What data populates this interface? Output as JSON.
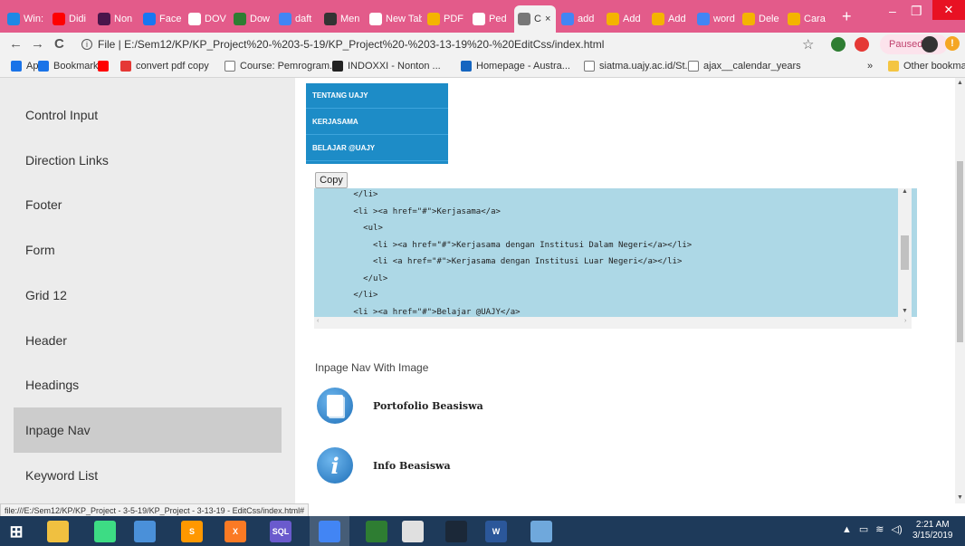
{
  "browser": {
    "tabs": [
      {
        "label": "Win:",
        "icon": "wifi-icon",
        "color": "#1e88e5"
      },
      {
        "label": "Didi",
        "icon": "youtube-icon",
        "color": "#ff0000"
      },
      {
        "label": "Non",
        "icon": "slack-icon",
        "color": "#4a154b"
      },
      {
        "label": "Face",
        "icon": "facebook-icon",
        "color": "#1877f2"
      },
      {
        "label": "DOV",
        "icon": "page-icon",
        "color": "#ffffff"
      },
      {
        "label": "Dow",
        "icon": "download-icon",
        "color": "#2e7d32"
      },
      {
        "label": "daft",
        "icon": "google-icon",
        "color": "#4285f4"
      },
      {
        "label": "Men",
        "icon": "y-icon",
        "color": "#333333"
      },
      {
        "label": "New Tab",
        "icon": "newtab-icon",
        "color": "#ffffff"
      },
      {
        "label": "PDF",
        "icon": "pdf-icon",
        "color": "#f4b400"
      },
      {
        "label": "Ped",
        "icon": "page-icon",
        "color": "#ffffff"
      },
      {
        "label": "C",
        "icon": "page-icon",
        "color": "#777777",
        "active": true
      },
      {
        "label": "add",
        "icon": "google-icon",
        "color": "#4285f4"
      },
      {
        "label": "Add",
        "icon": "puzzle-icon",
        "color": "#f4b400"
      },
      {
        "label": "Add",
        "icon": "puzzle-icon",
        "color": "#f4b400"
      },
      {
        "label": "word",
        "icon": "google-icon",
        "color": "#4285f4"
      },
      {
        "label": "Dele",
        "icon": "puzzle-icon",
        "color": "#f4b400"
      },
      {
        "label": "Cara",
        "icon": "puzzle-icon",
        "color": "#f4b400"
      }
    ],
    "new_tab_label": "+",
    "minimize": "–",
    "maximize": "❐",
    "close": "✕",
    "back": "←",
    "forward": "→",
    "reload": "C",
    "info_glyph": "i",
    "url": "File | E:/Sem12/KP/KP_Project%20-%203-5-19/KP_Project%20-%203-13-19%20-%20EditCss/index.html",
    "star": "☆",
    "paused_label": "Paused",
    "warning_glyph": "!"
  },
  "bookmarks": [
    {
      "label": "Apps",
      "icon": "apps-icon",
      "color": "#1a73e8"
    },
    {
      "label": "Bookmarks",
      "icon": "star-icon",
      "color": "#1a73e8"
    },
    {
      "label": "",
      "icon": "youtube-icon",
      "color": "#ff0000"
    },
    {
      "label": "convert pdf copy",
      "icon": "s-icon",
      "color": "#e53935"
    },
    {
      "label": "Course: Pemrogram...",
      "icon": "page-icon",
      "color": "#ffffff"
    },
    {
      "label": "INDOXXI - Nonton ...",
      "icon": "film-icon",
      "color": "#222222"
    },
    {
      "label": "Homepage - Austra...",
      "icon": "asterisk-icon",
      "color": "#1565c0"
    },
    {
      "label": "siatma.uajy.ac.id/St...",
      "icon": "page-icon",
      "color": "#ffffff"
    },
    {
      "label": "ajax__calendar_years",
      "icon": "page-icon",
      "color": "#ffffff"
    }
  ],
  "bookmarks_more": "»",
  "other_bookmarks": "Other bookmarks",
  "sidebar": {
    "items": [
      {
        "label": "Control Input"
      },
      {
        "label": "Direction Links"
      },
      {
        "label": "Footer"
      },
      {
        "label": "Form"
      },
      {
        "label": "Grid 12"
      },
      {
        "label": "Header"
      },
      {
        "label": "Headings"
      },
      {
        "label": "Inpage Nav",
        "active": true
      },
      {
        "label": "Keyword List"
      }
    ]
  },
  "menu": {
    "items": [
      "TENTANG UAJY",
      "KERJASAMA",
      "BELAJAR @UAJY"
    ]
  },
  "copy_button": "Copy",
  "code_lines": [
    "        </li>",
    "        <li ><a href=\"#\">Kerjasama</a>",
    "          <ul>",
    "            <li ><a href=\"#\">Kerjasama dengan Institusi Dalam Negeri</a></li>",
    "            <li <a href=\"#\">Kerjasama dengan Institusi Luar Negeri</a></li>",
    "          </ul>",
    "        </li>",
    "        <li ><a href=\"#\">Belajar @UAJY</a>"
  ],
  "scroll_left_glyph": "‹",
  "scroll_right_glyph": "›",
  "scroll_up_glyph": "▲",
  "scroll_down_glyph": "▼",
  "inpage_image": {
    "title": "Inpage Nav With Image",
    "items": [
      {
        "label": "Portofolio Beasiswa",
        "icon": "document-icon",
        "color": "#1e6fb8"
      },
      {
        "label": "Info Beasiswa",
        "icon": "info-icon",
        "color": "#1e6fb8"
      }
    ]
  },
  "status_url": "file:///E:/Sem12/KP/KP_Project - 3-5-19/KP_Project - 3-13-19 - EditCss/index.html#",
  "taskbar": {
    "icons": [
      {
        "name": "start-icon",
        "color": "#1e3a5a",
        "glyph": "⊞"
      },
      {
        "name": "file-explorer-icon",
        "color": "#f0c040",
        "glyph": ""
      },
      {
        "name": "android-studio-icon",
        "color": "#3ddc84",
        "glyph": ""
      },
      {
        "name": "network-icon",
        "color": "#4a90d9",
        "glyph": ""
      },
      {
        "name": "sublime-icon",
        "color": "#ff9800",
        "glyph": "S"
      },
      {
        "name": "xampp-icon",
        "color": "#fb7a24",
        "glyph": "X"
      },
      {
        "name": "sql-icon",
        "color": "#6a5acd",
        "glyph": "SQL"
      },
      {
        "name": "chrome-icon",
        "color": "#4285f4",
        "glyph": "",
        "active": true
      },
      {
        "name": "books-icon",
        "color": "#2e7d32",
        "glyph": ""
      },
      {
        "name": "window-icon",
        "color": "#e0e0e0",
        "glyph": ""
      },
      {
        "name": "steam-icon",
        "color": "#1b2838",
        "glyph": ""
      },
      {
        "name": "word-icon",
        "color": "#2b579a",
        "glyph": "W"
      },
      {
        "name": "paint-icon",
        "color": "#6fa8dc",
        "glyph": ""
      }
    ],
    "tray": "▲",
    "time": "2:21 AM",
    "date": "3/15/2019"
  }
}
